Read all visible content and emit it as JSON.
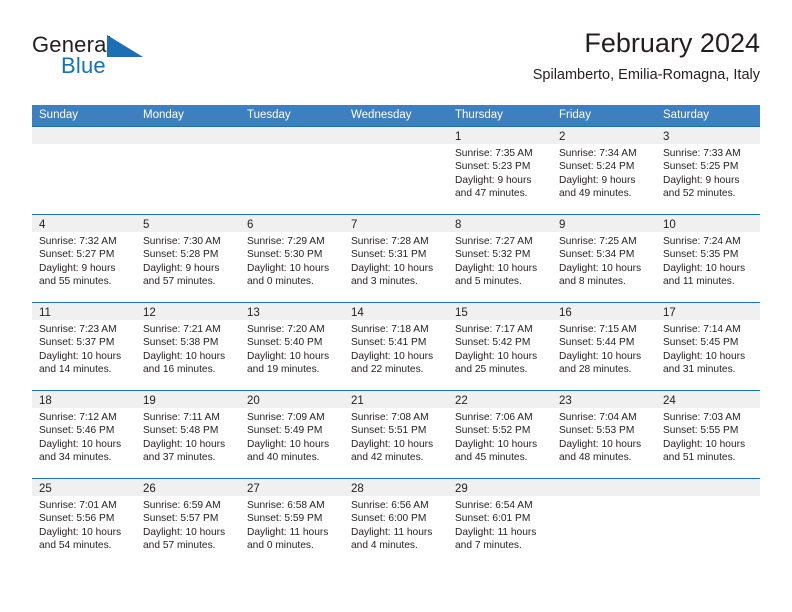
{
  "brand": {
    "name_part1": "General",
    "name_part2": "Blue",
    "triangle_color": "#1c6fb4",
    "blue_text_color": "#1273ba"
  },
  "header": {
    "title": "February 2024",
    "subtitle": "Spilamberto, Emilia-Romagna, Italy"
  },
  "theme": {
    "header_bar_color": "#3d7fbf",
    "week_rule_color": "#1c6fb4",
    "day_band_color": "#f0f0f0",
    "text_color": "#231f20"
  },
  "weekdays": [
    "Sunday",
    "Monday",
    "Tuesday",
    "Wednesday",
    "Thursday",
    "Friday",
    "Saturday"
  ],
  "weeks": [
    [
      {
        "day": "",
        "sunrise": "",
        "sunset": "",
        "daylight1": "",
        "daylight2": ""
      },
      {
        "day": "",
        "sunrise": "",
        "sunset": "",
        "daylight1": "",
        "daylight2": ""
      },
      {
        "day": "",
        "sunrise": "",
        "sunset": "",
        "daylight1": "",
        "daylight2": ""
      },
      {
        "day": "",
        "sunrise": "",
        "sunset": "",
        "daylight1": "",
        "daylight2": ""
      },
      {
        "day": "1",
        "sunrise": "Sunrise: 7:35 AM",
        "sunset": "Sunset: 5:23 PM",
        "daylight1": "Daylight: 9 hours",
        "daylight2": "and 47 minutes."
      },
      {
        "day": "2",
        "sunrise": "Sunrise: 7:34 AM",
        "sunset": "Sunset: 5:24 PM",
        "daylight1": "Daylight: 9 hours",
        "daylight2": "and 49 minutes."
      },
      {
        "day": "3",
        "sunrise": "Sunrise: 7:33 AM",
        "sunset": "Sunset: 5:25 PM",
        "daylight1": "Daylight: 9 hours",
        "daylight2": "and 52 minutes."
      }
    ],
    [
      {
        "day": "4",
        "sunrise": "Sunrise: 7:32 AM",
        "sunset": "Sunset: 5:27 PM",
        "daylight1": "Daylight: 9 hours",
        "daylight2": "and 55 minutes."
      },
      {
        "day": "5",
        "sunrise": "Sunrise: 7:30 AM",
        "sunset": "Sunset: 5:28 PM",
        "daylight1": "Daylight: 9 hours",
        "daylight2": "and 57 minutes."
      },
      {
        "day": "6",
        "sunrise": "Sunrise: 7:29 AM",
        "sunset": "Sunset: 5:30 PM",
        "daylight1": "Daylight: 10 hours",
        "daylight2": "and 0 minutes."
      },
      {
        "day": "7",
        "sunrise": "Sunrise: 7:28 AM",
        "sunset": "Sunset: 5:31 PM",
        "daylight1": "Daylight: 10 hours",
        "daylight2": "and 3 minutes."
      },
      {
        "day": "8",
        "sunrise": "Sunrise: 7:27 AM",
        "sunset": "Sunset: 5:32 PM",
        "daylight1": "Daylight: 10 hours",
        "daylight2": "and 5 minutes."
      },
      {
        "day": "9",
        "sunrise": "Sunrise: 7:25 AM",
        "sunset": "Sunset: 5:34 PM",
        "daylight1": "Daylight: 10 hours",
        "daylight2": "and 8 minutes."
      },
      {
        "day": "10",
        "sunrise": "Sunrise: 7:24 AM",
        "sunset": "Sunset: 5:35 PM",
        "daylight1": "Daylight: 10 hours",
        "daylight2": "and 11 minutes."
      }
    ],
    [
      {
        "day": "11",
        "sunrise": "Sunrise: 7:23 AM",
        "sunset": "Sunset: 5:37 PM",
        "daylight1": "Daylight: 10 hours",
        "daylight2": "and 14 minutes."
      },
      {
        "day": "12",
        "sunrise": "Sunrise: 7:21 AM",
        "sunset": "Sunset: 5:38 PM",
        "daylight1": "Daylight: 10 hours",
        "daylight2": "and 16 minutes."
      },
      {
        "day": "13",
        "sunrise": "Sunrise: 7:20 AM",
        "sunset": "Sunset: 5:40 PM",
        "daylight1": "Daylight: 10 hours",
        "daylight2": "and 19 minutes."
      },
      {
        "day": "14",
        "sunrise": "Sunrise: 7:18 AM",
        "sunset": "Sunset: 5:41 PM",
        "daylight1": "Daylight: 10 hours",
        "daylight2": "and 22 minutes."
      },
      {
        "day": "15",
        "sunrise": "Sunrise: 7:17 AM",
        "sunset": "Sunset: 5:42 PM",
        "daylight1": "Daylight: 10 hours",
        "daylight2": "and 25 minutes."
      },
      {
        "day": "16",
        "sunrise": "Sunrise: 7:15 AM",
        "sunset": "Sunset: 5:44 PM",
        "daylight1": "Daylight: 10 hours",
        "daylight2": "and 28 minutes."
      },
      {
        "day": "17",
        "sunrise": "Sunrise: 7:14 AM",
        "sunset": "Sunset: 5:45 PM",
        "daylight1": "Daylight: 10 hours",
        "daylight2": "and 31 minutes."
      }
    ],
    [
      {
        "day": "18",
        "sunrise": "Sunrise: 7:12 AM",
        "sunset": "Sunset: 5:46 PM",
        "daylight1": "Daylight: 10 hours",
        "daylight2": "and 34 minutes."
      },
      {
        "day": "19",
        "sunrise": "Sunrise: 7:11 AM",
        "sunset": "Sunset: 5:48 PM",
        "daylight1": "Daylight: 10 hours",
        "daylight2": "and 37 minutes."
      },
      {
        "day": "20",
        "sunrise": "Sunrise: 7:09 AM",
        "sunset": "Sunset: 5:49 PM",
        "daylight1": "Daylight: 10 hours",
        "daylight2": "and 40 minutes."
      },
      {
        "day": "21",
        "sunrise": "Sunrise: 7:08 AM",
        "sunset": "Sunset: 5:51 PM",
        "daylight1": "Daylight: 10 hours",
        "daylight2": "and 42 minutes."
      },
      {
        "day": "22",
        "sunrise": "Sunrise: 7:06 AM",
        "sunset": "Sunset: 5:52 PM",
        "daylight1": "Daylight: 10 hours",
        "daylight2": "and 45 minutes."
      },
      {
        "day": "23",
        "sunrise": "Sunrise: 7:04 AM",
        "sunset": "Sunset: 5:53 PM",
        "daylight1": "Daylight: 10 hours",
        "daylight2": "and 48 minutes."
      },
      {
        "day": "24",
        "sunrise": "Sunrise: 7:03 AM",
        "sunset": "Sunset: 5:55 PM",
        "daylight1": "Daylight: 10 hours",
        "daylight2": "and 51 minutes."
      }
    ],
    [
      {
        "day": "25",
        "sunrise": "Sunrise: 7:01 AM",
        "sunset": "Sunset: 5:56 PM",
        "daylight1": "Daylight: 10 hours",
        "daylight2": "and 54 minutes."
      },
      {
        "day": "26",
        "sunrise": "Sunrise: 6:59 AM",
        "sunset": "Sunset: 5:57 PM",
        "daylight1": "Daylight: 10 hours",
        "daylight2": "and 57 minutes."
      },
      {
        "day": "27",
        "sunrise": "Sunrise: 6:58 AM",
        "sunset": "Sunset: 5:59 PM",
        "daylight1": "Daylight: 11 hours",
        "daylight2": "and 0 minutes."
      },
      {
        "day": "28",
        "sunrise": "Sunrise: 6:56 AM",
        "sunset": "Sunset: 6:00 PM",
        "daylight1": "Daylight: 11 hours",
        "daylight2": "and 4 minutes."
      },
      {
        "day": "29",
        "sunrise": "Sunrise: 6:54 AM",
        "sunset": "Sunset: 6:01 PM",
        "daylight1": "Daylight: 11 hours",
        "daylight2": "and 7 minutes."
      },
      {
        "day": "",
        "sunrise": "",
        "sunset": "",
        "daylight1": "",
        "daylight2": ""
      },
      {
        "day": "",
        "sunrise": "",
        "sunset": "",
        "daylight1": "",
        "daylight2": ""
      }
    ]
  ]
}
